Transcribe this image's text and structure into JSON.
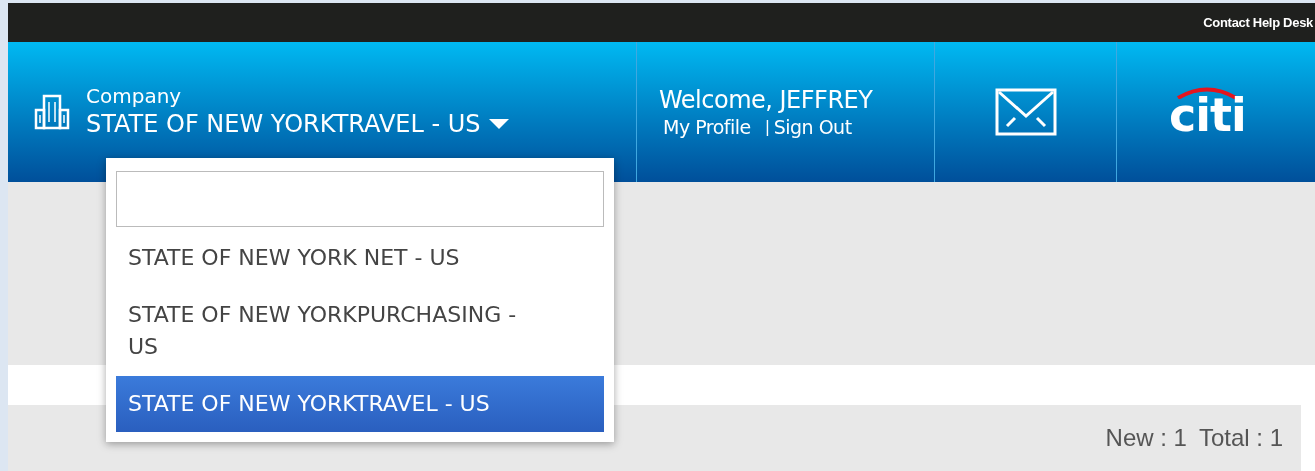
{
  "top_bar": {
    "help_link": "Contact Help Desk"
  },
  "header": {
    "company_label": "Company",
    "company_name": "STATE OF NEW YORKTRAVEL - US",
    "welcome": "Welcome, JEFFREY",
    "profile_link": "My Profile",
    "separator": "|",
    "sign_out_link": "Sign Out",
    "logo_text": "citi"
  },
  "company_dropdown": {
    "expanded": true,
    "options": [
      {
        "label": "STATE OF NEW YORK NET - US",
        "selected": false
      },
      {
        "label": "STATE OF NEW YORKPURCHASING - US",
        "selected": false
      },
      {
        "label": "STATE OF NEW YORKTRAVEL - US",
        "selected": true
      }
    ]
  },
  "counts": {
    "new": "New : 1",
    "total": "Total : 1"
  }
}
